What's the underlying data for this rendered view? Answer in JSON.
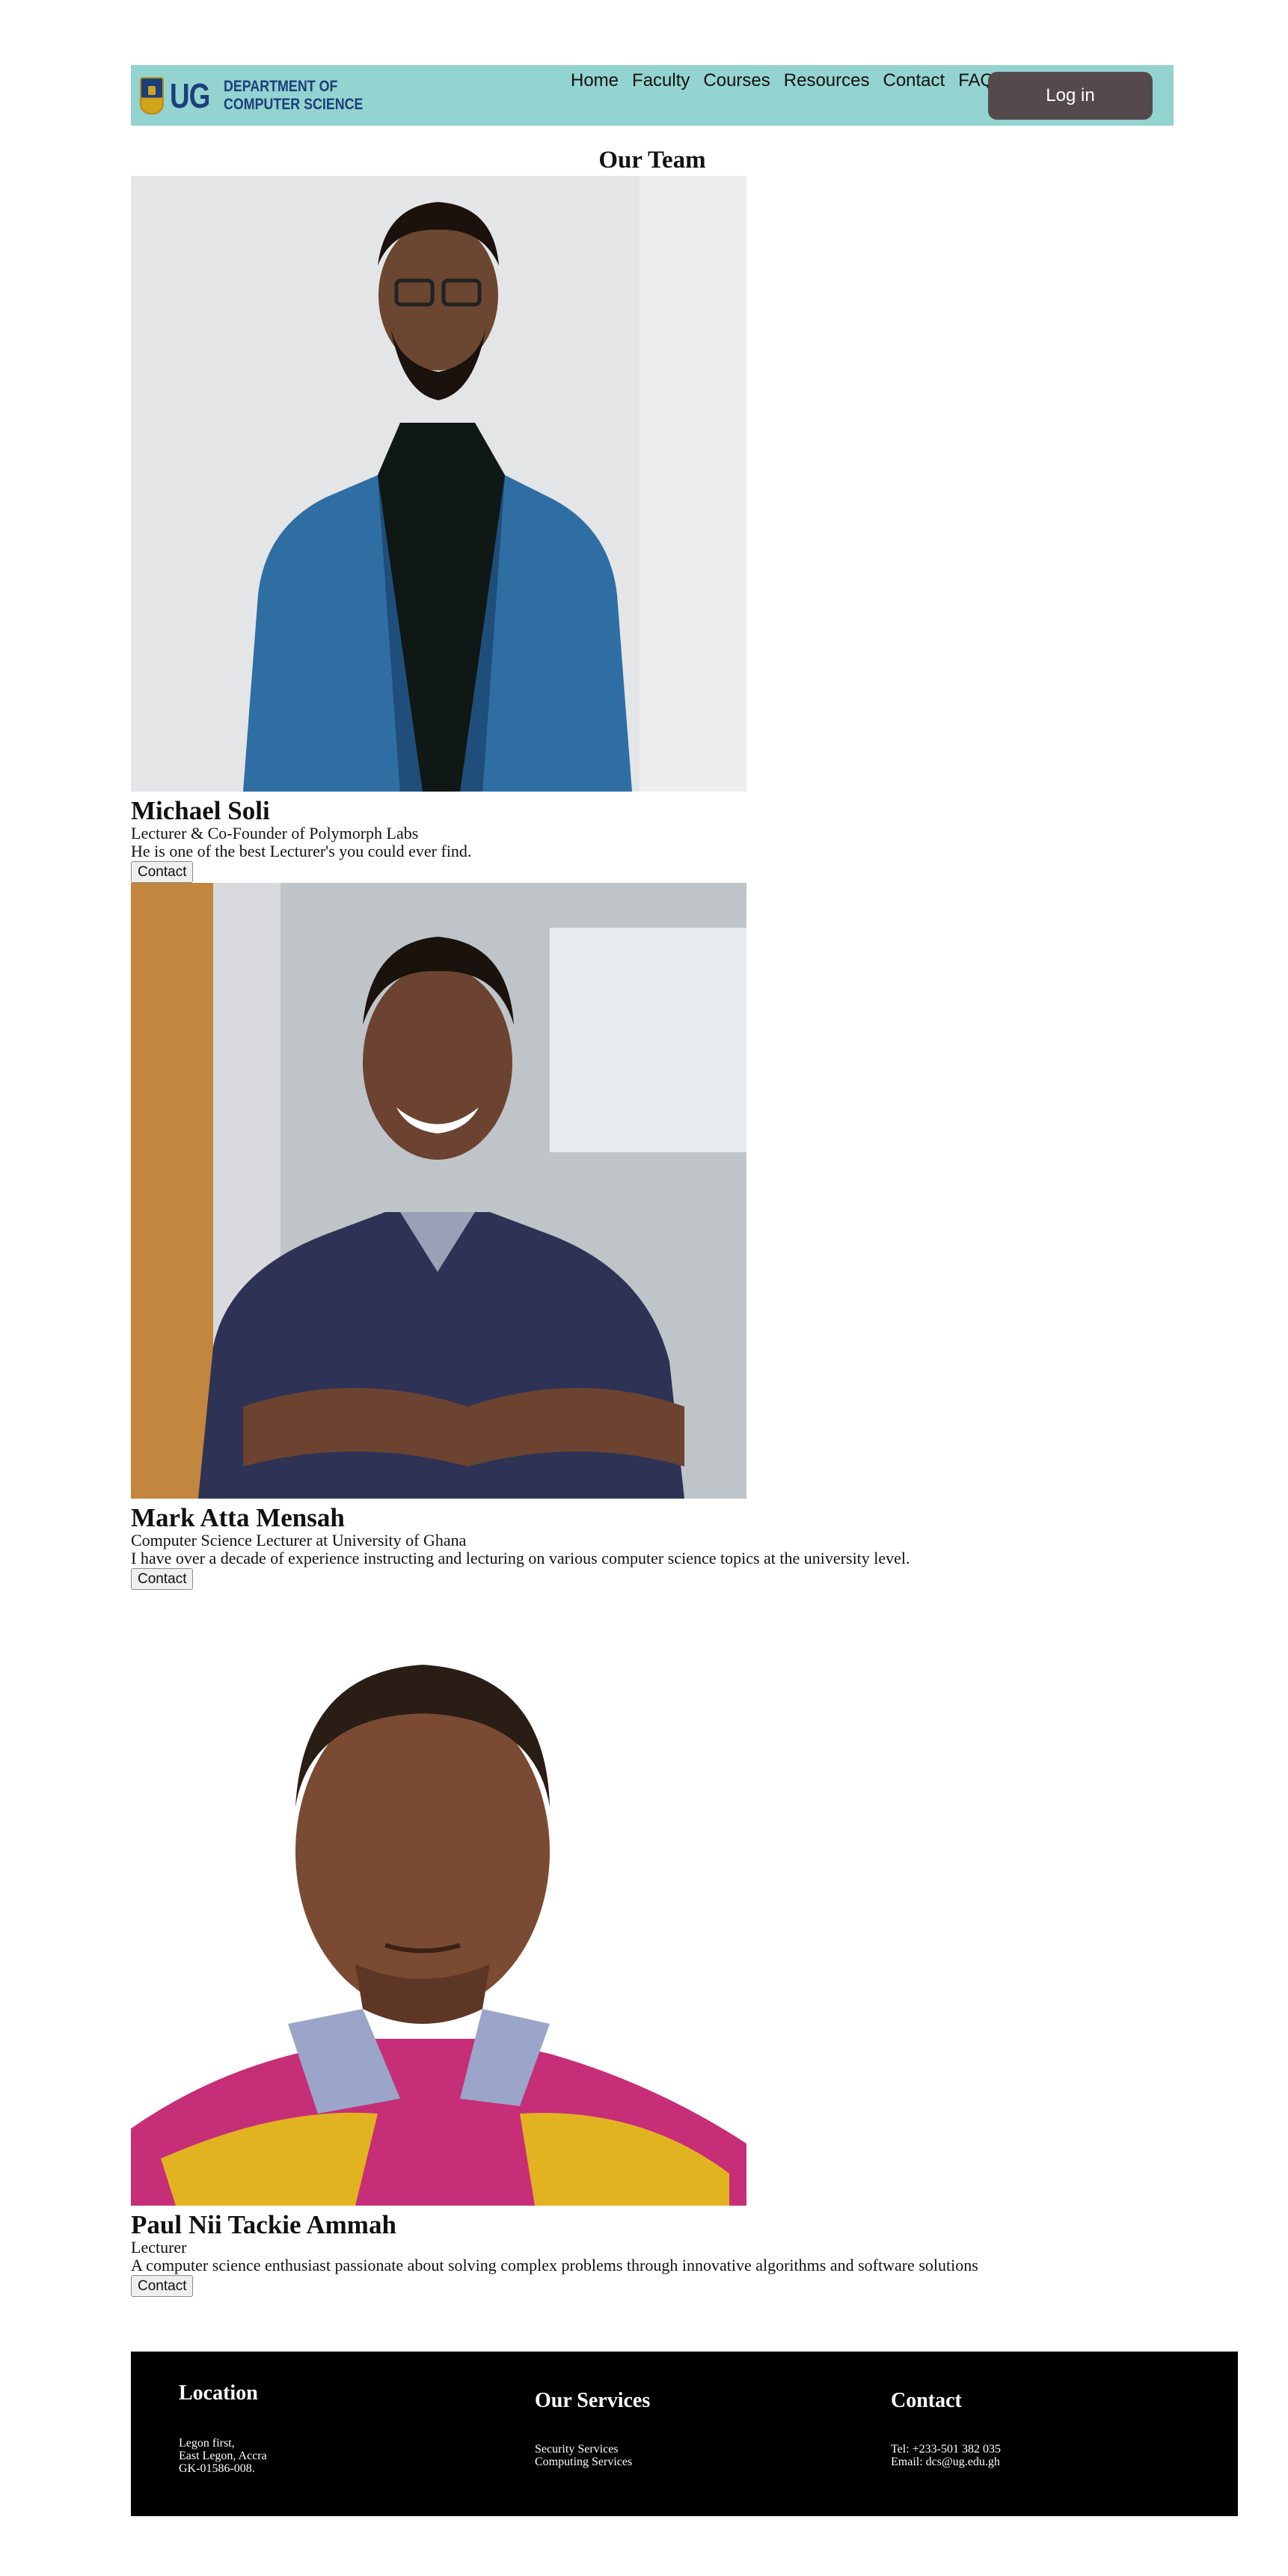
{
  "header": {
    "logo_text": "UG",
    "dept_line1": "DEPARTMENT OF",
    "dept_line2": "COMPUTER SCIENCE",
    "nav": [
      "Home",
      "Faculty",
      "Courses",
      "Resources",
      "Contact",
      "FAQ"
    ],
    "login_label": "Log in",
    "colors": {
      "bar": "#93d3d0",
      "login_bg": "#544a4b",
      "brand": "#1c3f7a"
    }
  },
  "team": {
    "title": "Our Team",
    "members": [
      {
        "name": "Michael Soli",
        "role": "Lecturer & Co-Founder of Polymorph Labs",
        "bio": "He is one of the best Lecturer's you could ever find.",
        "contact_label": "Contact"
      },
      {
        "name": "Mark Atta Mensah",
        "role": "Computer Science Lecturer at University of Ghana",
        "bio": "I have over a decade of experience instructing and lecturing on various computer science topics at the university level.",
        "contact_label": "Contact"
      },
      {
        "name": "Paul Nii Tackie Ammah",
        "role": "Lecturer",
        "bio": "A computer science enthusiast passionate about solving complex problems through innovative algorithms and software solutions",
        "contact_label": "Contact"
      }
    ]
  },
  "footer": {
    "location": {
      "title": "Location",
      "lines": [
        "Legon first,",
        "East Legon, Accra",
        "GK-01586-008."
      ]
    },
    "services": {
      "title": "Our Services",
      "lines": [
        "Security Services",
        "Computing Services"
      ]
    },
    "contact": {
      "title": "Contact",
      "lines": [
        "Tel: +233-501 382 035",
        "Email: dcs@ug.edu.gh"
      ]
    }
  }
}
